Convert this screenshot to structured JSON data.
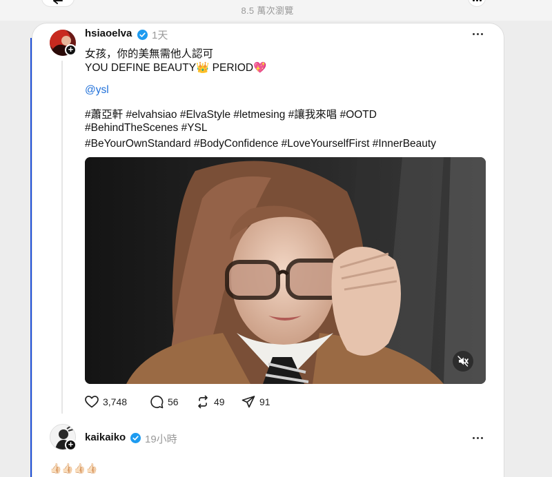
{
  "header": {
    "views": "8.5 萬次瀏覽"
  },
  "post": {
    "username": "hsiaoelva",
    "time": "1天",
    "text_line1": "女孩，你的美無需他人認可",
    "text_line2": "YOU DEFINE BEAUTY👑 PERIOD💖",
    "mention": "@ysl",
    "hashtags_line1": "#蕭亞軒 #elvahsiao #ElvaStyle #letmesing #讓我來唱 #OOTD",
    "hashtags_line2": "#BehindTheScenes #YSL",
    "hashtags_line3": "#BeYourOwnStandard #BodyConfidence #LoveYourselfFirst #InnerBeauty",
    "likes": "3,748",
    "comments": "56",
    "reposts": "49",
    "shares": "91"
  },
  "reply": {
    "username": "kaikaiko",
    "time": "19小時",
    "text": "👍🏻👍🏻👍🏻👍🏻"
  },
  "colors": {
    "verified": "#1d9bf0",
    "mention": "#1e6fd9",
    "frame_accent": "#1d4ed8"
  },
  "icons": [
    "back-arrow-icon",
    "more-icon",
    "verified-icon",
    "add-follow-icon",
    "heart-icon",
    "comment-icon",
    "repost-icon",
    "share-icon",
    "mute-icon"
  ]
}
